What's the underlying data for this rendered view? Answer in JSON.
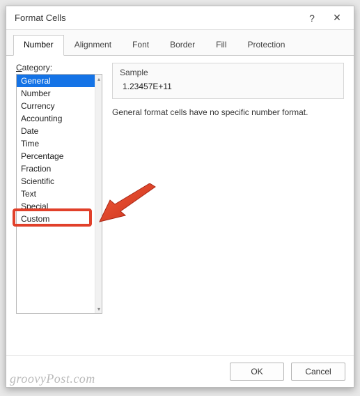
{
  "dialog": {
    "title": "Format Cells",
    "help_icon": "?",
    "close_icon": "✕"
  },
  "tabs": {
    "items": [
      {
        "label": "Number",
        "active": true
      },
      {
        "label": "Alignment",
        "active": false
      },
      {
        "label": "Font",
        "active": false
      },
      {
        "label": "Border",
        "active": false
      },
      {
        "label": "Fill",
        "active": false
      },
      {
        "label": "Protection",
        "active": false
      }
    ]
  },
  "number_tab": {
    "category_label": "Category:",
    "categories": [
      "General",
      "Number",
      "Currency",
      "Accounting",
      "Date",
      "Time",
      "Percentage",
      "Fraction",
      "Scientific",
      "Text",
      "Special",
      "Custom"
    ],
    "selected_index": 0,
    "highlighted_index": 11,
    "sample": {
      "label": "Sample",
      "value": "1.23457E+11"
    },
    "description": "General format cells have no specific number format."
  },
  "buttons": {
    "ok": "OK",
    "cancel": "Cancel"
  },
  "watermark": "groovyPost.com",
  "annotation": {
    "highlight_color": "#e1402a",
    "arrow_points_to": "category-custom"
  }
}
